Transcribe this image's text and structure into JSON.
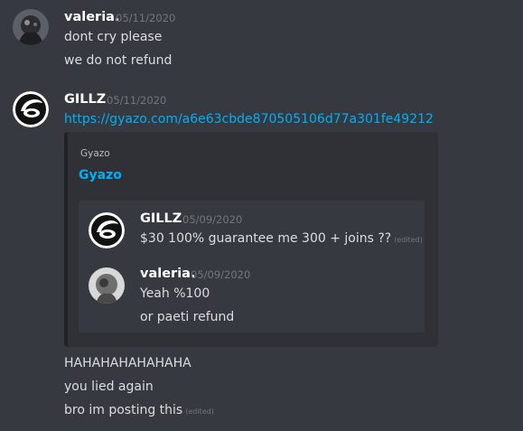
{
  "messages": {
    "first": {
      "username": "valeria.",
      "timestamp": "05/11/2020",
      "lines": [
        "dont cry please",
        "we do not refund"
      ]
    },
    "second": {
      "username": "GILLZ",
      "timestamp": "05/11/2020",
      "link": "https://gyazo.com/a6e63cbde870505106d77a301fe49212",
      "embed": {
        "provider": "Gyazo",
        "title": "Gyazo",
        "screenshot": {
          "msg1": {
            "username": "GILLZ",
            "timestamp": "05/09/2020",
            "text": "$30 100% guarantee me 300 + joins ??",
            "edited": "(edited)"
          },
          "msg2": {
            "username": "valeria.",
            "timestamp": "05/09/2020",
            "lines": [
              "Yeah %100",
              "or paeti refund"
            ]
          }
        }
      },
      "followups": [
        "HAHAHAHAHAHAHA",
        "you lied again",
        "bro im posting this"
      ],
      "last_edited": "(edited)"
    }
  },
  "icons": {
    "gillz_avatar": "gillz-logo-icon",
    "valeria_avatar": "valeria-photo-avatar"
  },
  "colors": {
    "background": "#36393f",
    "embed_background": "#2f3136",
    "link": "#00b0f4",
    "username": "#ffffff",
    "timestamp": "#72767d",
    "text": "#dcddde"
  }
}
